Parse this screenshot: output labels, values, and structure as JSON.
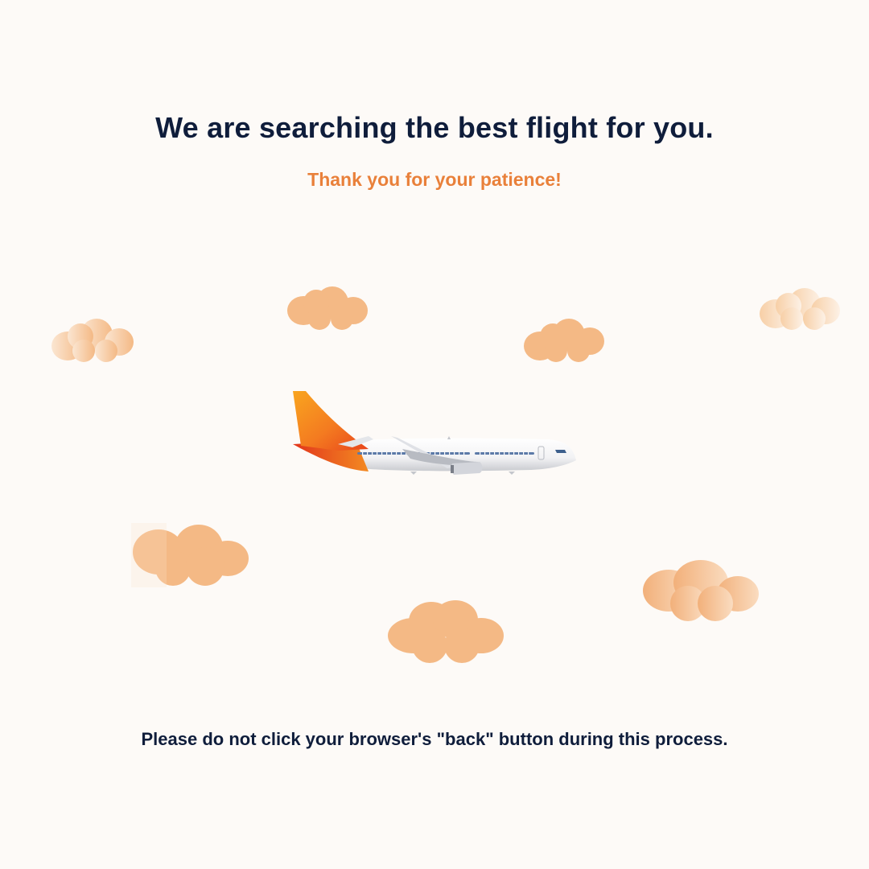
{
  "loader": {
    "headline": "We are searching the best flight for you.",
    "subline": "Thank you for your patience!",
    "footnote": "Please do not click your browser's \"back\" button during this process."
  },
  "illustration": {
    "plane_icon": "airplane-icon",
    "cloud_icon": "cloud-icon",
    "colors": {
      "background": "#fdfaf7",
      "heading": "#0f1d3b",
      "accent": "#e9803a",
      "cloud": "#f4b985",
      "tail_orange": "#f47b20",
      "tail_red": "#e53a1c"
    }
  }
}
